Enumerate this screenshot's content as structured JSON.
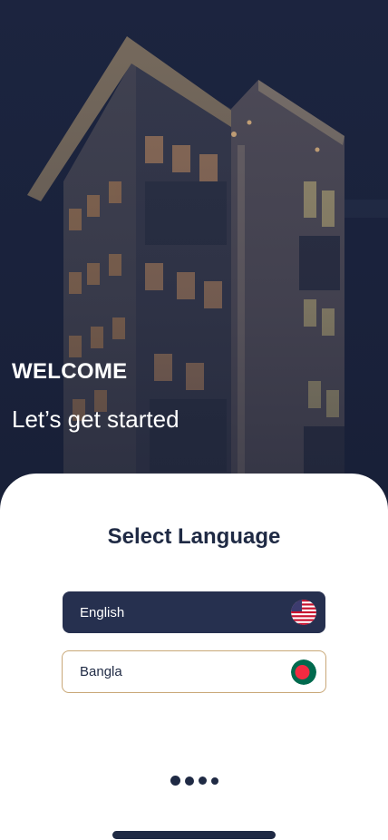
{
  "hero": {
    "title": "WELCOME",
    "subtitle": "Let’s get started",
    "background_image": "night-building-photo"
  },
  "language_sheet": {
    "title": "Select Language",
    "options": [
      {
        "label": "English",
        "flag_icon": "usa-flag-icon",
        "selected": true
      },
      {
        "label": "Bangla",
        "flag_icon": "bangladesh-flag-icon",
        "selected": false
      }
    ]
  },
  "pager": {
    "dot_count": 4,
    "active_index": 0
  },
  "colors": {
    "primary": "#26304f",
    "text_dark": "#1f2a44",
    "inactive_border": "#c9a878",
    "background": "#ffffff"
  }
}
